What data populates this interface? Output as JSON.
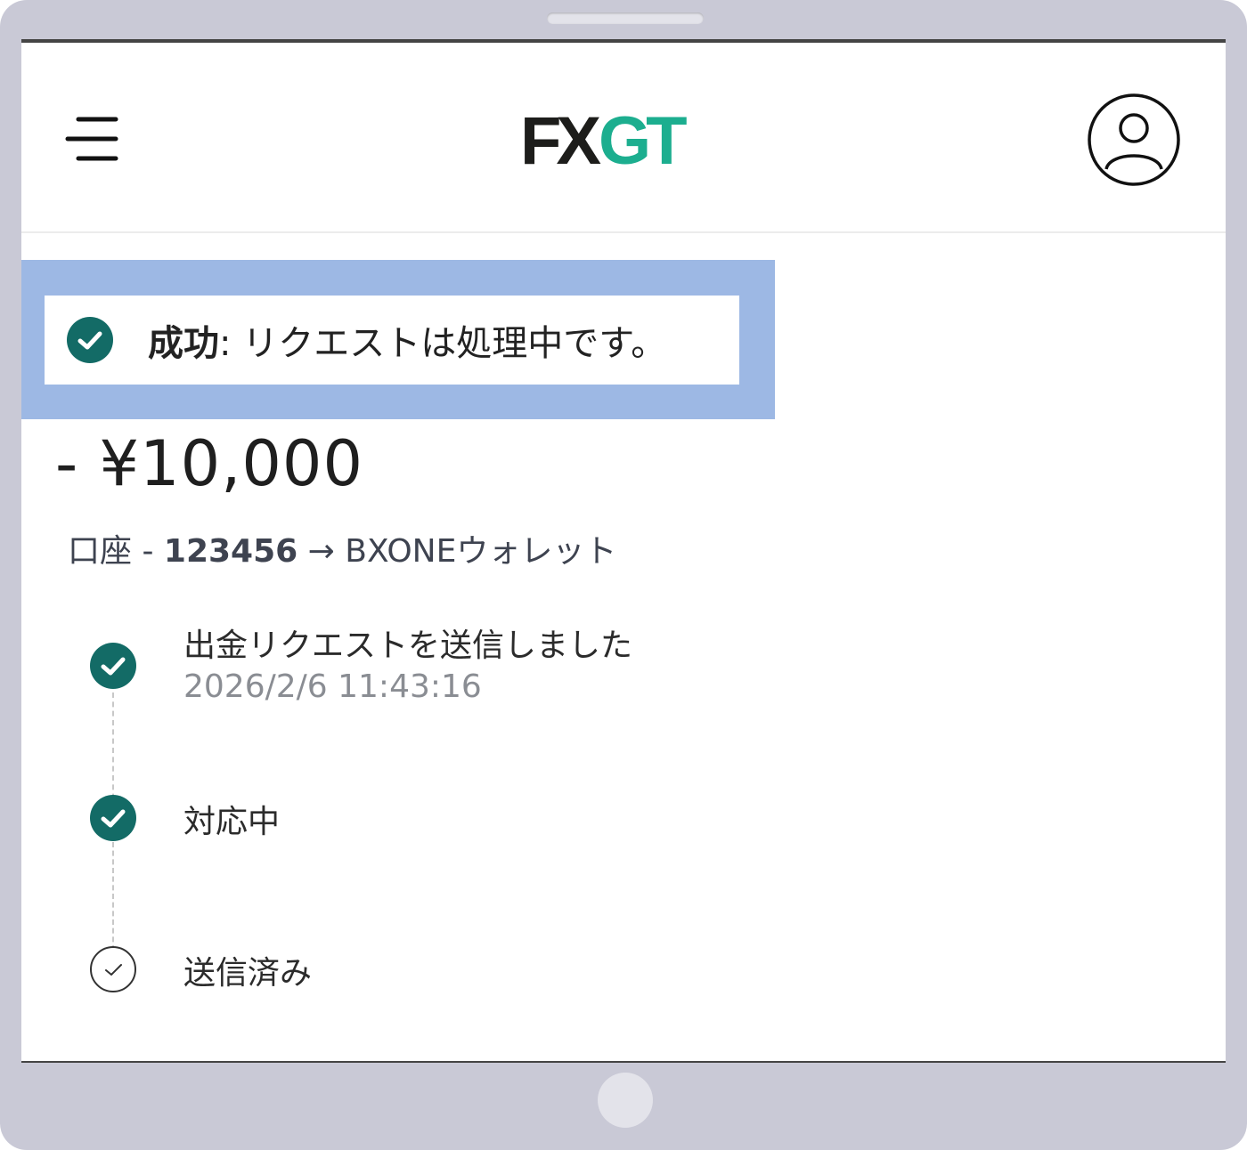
{
  "brand": {
    "logo_dark": "FX",
    "logo_accent": "GT",
    "accent_color": "#1cae8f",
    "dark_color": "#1d1d1b"
  },
  "header": {
    "menu_icon": "menu-icon",
    "profile_icon": "user-profile-icon"
  },
  "banner": {
    "status_label": "成功",
    "message": ": リクエストは処理中です。",
    "icon": "check-circle-icon",
    "icon_color": "#136b66"
  },
  "transaction": {
    "amount": "- ¥10,000",
    "from_label": "口座 -",
    "account_number": "123456",
    "arrow": "→",
    "destination": "BXONEウォレット"
  },
  "timeline": {
    "steps": [
      {
        "title": "出金リクエストを送信しました",
        "timestamp": "2026/2/6 11:43:16",
        "status": "completed"
      },
      {
        "title": "対応中",
        "timestamp": "",
        "status": "completed"
      },
      {
        "title": "送信済み",
        "timestamp": "",
        "status": "pending"
      }
    ]
  }
}
